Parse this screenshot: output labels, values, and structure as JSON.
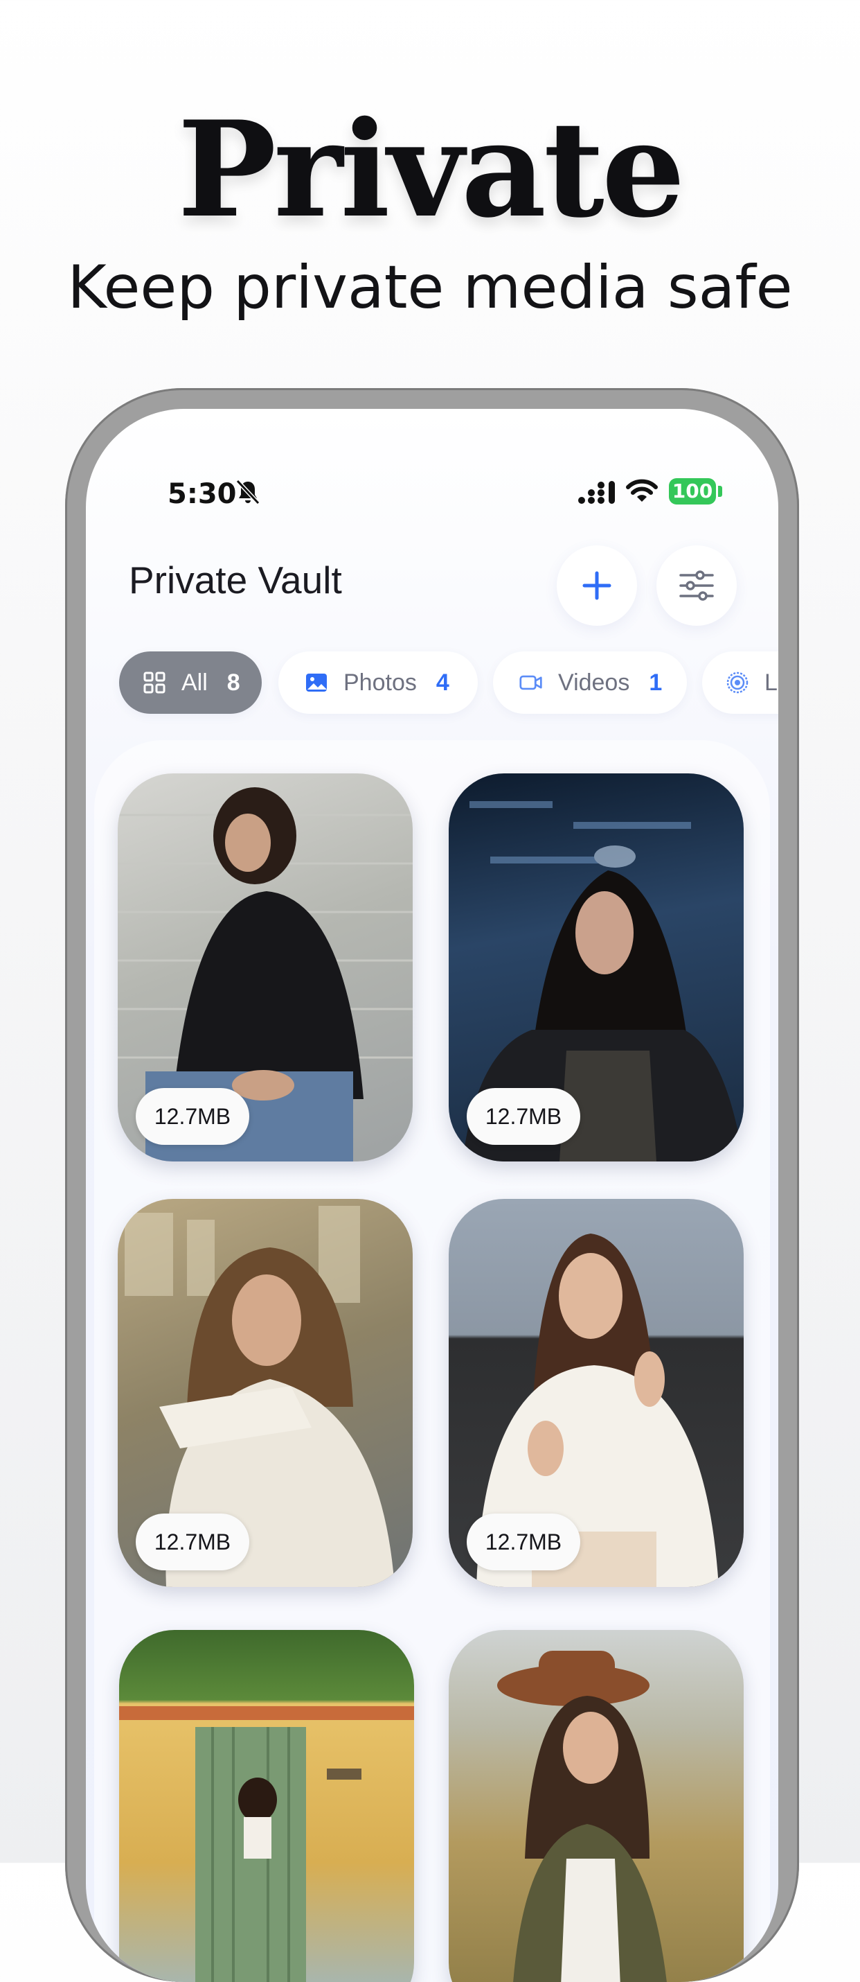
{
  "hero": {
    "title": "Private",
    "subtitle": "Keep private media safe"
  },
  "status_bar": {
    "time": "5:30",
    "battery": "100",
    "icons": [
      "bell-slash-icon",
      "signal-icon",
      "wifi-icon",
      "battery-icon"
    ]
  },
  "header": {
    "title": "Private Vault",
    "actions": [
      "plus-icon",
      "sliders-icon"
    ]
  },
  "filters": [
    {
      "label": "All",
      "count": "8",
      "icon": "grid-icon",
      "selected": true
    },
    {
      "label": "Photos",
      "count": "4",
      "icon": "image-icon",
      "selected": false
    },
    {
      "label": "Videos",
      "count": "1",
      "icon": "video-icon",
      "selected": false
    },
    {
      "label": "L",
      "count": "",
      "icon": "live-icon",
      "selected": false
    }
  ],
  "media": [
    {
      "size": "12.7MB"
    },
    {
      "size": "12.7MB"
    },
    {
      "size": "12.7MB"
    },
    {
      "size": "12.7MB"
    },
    {
      "size": ""
    },
    {
      "size": ""
    }
  ],
  "colors": {
    "accent": "#2f6df6",
    "chip_selected": "#80848d",
    "battery": "#34c759"
  }
}
